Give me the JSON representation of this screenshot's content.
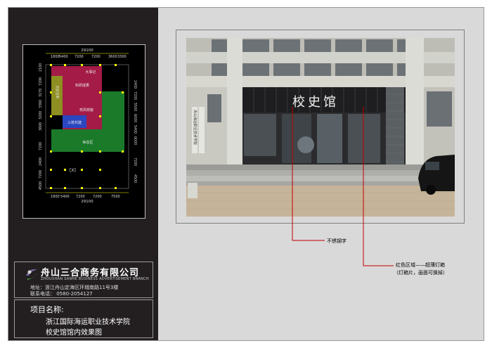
{
  "plan": {
    "dims_top_total": "29100",
    "dims_top": [
      "1800",
      "5400",
      "7200",
      "7200",
      "3600",
      "3300"
    ],
    "dims_bottom": [
      "1800",
      "5400",
      "7200",
      "7200",
      "7500"
    ],
    "dims_bottom_total": "29100",
    "dims_left": [
      "2100",
      "7200",
      "3270",
      "3360",
      "3200",
      "3600",
      "7200",
      "2400",
      "7200",
      "4500"
    ],
    "dims_right": [
      "2400",
      "7200",
      "5500",
      "6000",
      "5400",
      "6000",
      "7200",
      "4500"
    ],
    "rooms": {
      "r1": "大事记",
      "r2": "科研成果",
      "r3": "校风校貌",
      "r4": "三校共建",
      "r5": "休息区",
      "r6": "历史沿革"
    },
    "entrance": "[X]",
    "colors": {
      "red": "#a31b46",
      "green": "#1a7a2a",
      "blue": "#2a46c0",
      "olive": "#8e8e22",
      "dims": "#ffff00"
    }
  },
  "company": {
    "name": "舟山三合商务有限公司",
    "name_en": "ZHOUSHAN SANHE BUSINESS ADVERTISEMENT BRANCH",
    "address": "地址：浙江舟山定海区环城南路11号3楼",
    "phone": "联系电话：   0580-2054127"
  },
  "project": {
    "title": "项目名称:",
    "line1": "浙江国际海运职业技术学院",
    "line2": "校史馆馆内效果图"
  },
  "photo": {
    "sign_text": "校史馆",
    "side_plaque": "舟山海运职业技术学院"
  },
  "callouts": {
    "c1": "不锈钢字",
    "c2_line1": "红色区域——超薄灯箱",
    "c2_line2": "（灯箱片，画面可换掉）",
    "line_color": "#c00000"
  }
}
